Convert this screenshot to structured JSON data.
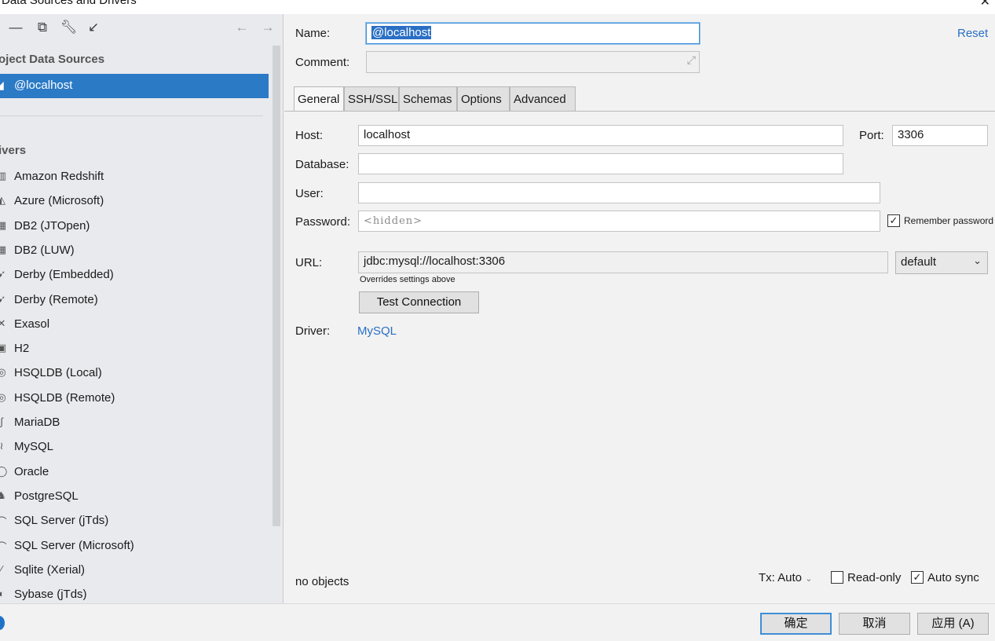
{
  "window": {
    "title": "Data Sources and Drivers",
    "close_icon": "close-icon"
  },
  "toolbar": {
    "icons": [
      "remove-icon",
      "copy-icon",
      "wrench-icon",
      "import-icon",
      "back-arrow-icon",
      "forward-arrow-icon"
    ]
  },
  "sidebar": {
    "project_header": "oject Data Sources",
    "selected_source": "@localhost",
    "drivers_header": "ivers",
    "drivers": [
      {
        "label": "Amazon Redshift",
        "icon": "redshift-icon"
      },
      {
        "label": "Azure (Microsoft)",
        "icon": "azure-icon"
      },
      {
        "label": "DB2 (JTOpen)",
        "icon": "db2-icon"
      },
      {
        "label": "DB2 (LUW)",
        "icon": "db2-icon"
      },
      {
        "label": "Derby (Embedded)",
        "icon": "derby-icon"
      },
      {
        "label": "Derby (Remote)",
        "icon": "derby-icon"
      },
      {
        "label": "Exasol",
        "icon": "exasol-icon"
      },
      {
        "label": "H2",
        "icon": "h2-icon"
      },
      {
        "label": "HSQLDB (Local)",
        "icon": "hsqldb-icon"
      },
      {
        "label": "HSQLDB (Remote)",
        "icon": "hsqldb-icon"
      },
      {
        "label": "MariaDB",
        "icon": "mariadb-icon"
      },
      {
        "label": "MySQL",
        "icon": "mysql-icon"
      },
      {
        "label": "Oracle",
        "icon": "oracle-icon"
      },
      {
        "label": "PostgreSQL",
        "icon": "postgresql-icon"
      },
      {
        "label": "SQL Server (jTds)",
        "icon": "sqlserver-icon"
      },
      {
        "label": "SQL Server (Microsoft)",
        "icon": "sqlserver-icon"
      },
      {
        "label": "Sqlite (Xerial)",
        "icon": "sqlite-icon"
      },
      {
        "label": "Sybase (jTds)",
        "icon": "sybase-icon"
      }
    ]
  },
  "form": {
    "name_label": "Name:",
    "name_value": "@localhost",
    "comment_label": "Comment:",
    "comment_value": "",
    "reset_label": "Reset",
    "tabs": [
      "General",
      "SSH/SSL",
      "Schemas",
      "Options",
      "Advanced"
    ],
    "active_tab": "General",
    "host_label": "Host:",
    "host_value": "localhost",
    "port_label": "Port:",
    "port_value": "3306",
    "database_label": "Database:",
    "database_value": "",
    "user_label": "User:",
    "user_value": "",
    "password_label": "Password:",
    "password_placeholder": "<hidden>",
    "remember_password_label": "Remember password",
    "remember_password_checked": true,
    "url_label": "URL:",
    "url_value": "jdbc:mysql://localhost:3306",
    "url_mode": "default",
    "url_hint": "Overrides settings above",
    "test_connection_label": "Test Connection",
    "driver_label": "Driver:",
    "driver_value": "MySQL"
  },
  "status": {
    "objects_text": "no objects",
    "tx_label": "Tx: Auto",
    "readonly_label": "Read-only",
    "readonly_checked": false,
    "autosync_label": "Auto sync",
    "autosync_checked": true
  },
  "footer": {
    "ok_label": "确定",
    "cancel_label": "取消",
    "apply_label": "应用 (A)"
  },
  "colors": {
    "accent": "#2a7ac6",
    "link": "#2a6fc4",
    "sidebar_bg": "#e8eaee",
    "panel_bg": "#f2f2f2"
  }
}
